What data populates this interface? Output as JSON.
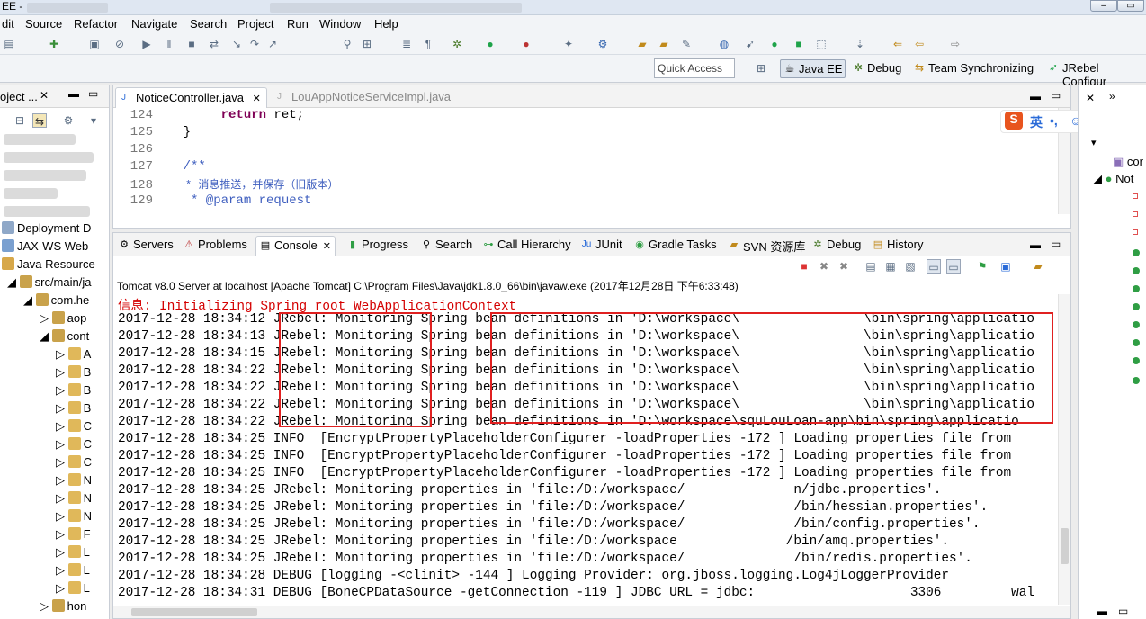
{
  "window": {
    "title_fragment": "EE -",
    "close_label": "✕",
    "max_label": "▭"
  },
  "menu": [
    "dit",
    "Source",
    "Refactor",
    "Navigate",
    "Search",
    "Project",
    "Run",
    "Window",
    "Help"
  ],
  "toolbar": {
    "quick_access": "Quick Access"
  },
  "perspectives": [
    {
      "label": "Java EE",
      "icon": "javaee-icon",
      "active": true
    },
    {
      "label": "Debug",
      "icon": "bug-icon"
    },
    {
      "label": "Team Synchronizing",
      "icon": "sync-icon"
    },
    {
      "label": "JRebel Configur",
      "icon": "jrebel-icon"
    }
  ],
  "explorer": {
    "tab_label": "oject ...",
    "items": [
      {
        "label": "Deployment D",
        "indent": 0
      },
      {
        "label": "JAX-WS Web",
        "indent": 0
      },
      {
        "label": "Java Resource",
        "indent": 0
      },
      {
        "label": "src/main/ja",
        "indent": 1
      },
      {
        "label": "com.he",
        "indent": 2
      },
      {
        "label": "aop",
        "indent": 3
      },
      {
        "label": "cont",
        "indent": 3
      }
    ],
    "class_letters": [
      "A",
      "B",
      "B",
      "B",
      "C",
      "C",
      "C",
      "N",
      "N",
      "N",
      "F",
      "L",
      "L",
      "L"
    ],
    "last_item": "hon"
  },
  "editor": {
    "tabs": [
      {
        "label": "NoticeController.java",
        "active": true
      },
      {
        "label": "LouAppNoticeServiceImpl.java",
        "active": false
      }
    ],
    "lines": [
      {
        "num": "124",
        "code": "        return ret;"
      },
      {
        "num": "125",
        "code": "    }"
      },
      {
        "num": "126",
        "code": ""
      },
      {
        "num": "127",
        "code": "    /**"
      },
      {
        "num": "128",
        "code": "     * 消息推送，并保存（旧版本）"
      },
      {
        "num": "129",
        "code": "     * @param request"
      }
    ]
  },
  "console": {
    "tabs": [
      {
        "label": "Servers",
        "icon": "servers-icon"
      },
      {
        "label": "Problems",
        "icon": "problems-icon"
      },
      {
        "label": "Console",
        "icon": "console-icon",
        "active": true
      },
      {
        "label": "Progress",
        "icon": "progress-icon"
      },
      {
        "label": "Search",
        "icon": "search-icon"
      },
      {
        "label": "Call Hierarchy",
        "icon": "hierarchy-icon"
      },
      {
        "label": "JUnit",
        "icon": "junit-icon"
      },
      {
        "label": "Gradle Tasks",
        "icon": "gradle-icon"
      },
      {
        "label": "SVN 资源库",
        "icon": "svn-icon"
      },
      {
        "label": "Debug",
        "icon": "bug-icon"
      },
      {
        "label": "History",
        "icon": "history-icon"
      }
    ],
    "status": "Tomcat v8.0 Server at localhost [Apache Tomcat] C:\\Program Files\\Java\\jdk1.8.0_66\\bin\\javaw.exe (2017年12月28日 下午6:33:48)",
    "lines": [
      {
        "text": "信息: Initializing Spring root WebApplicationContext",
        "red": true
      },
      {
        "text": "2017-12-28 18:34:12 JRebel: Monitoring Spring bean definitions in 'D:\\workspace\\                \\bin\\spring\\applicatio"
      },
      {
        "text": "2017-12-28 18:34:13 JRebel: Monitoring Spring bean definitions in 'D:\\workspace\\                \\bin\\spring\\applicatio"
      },
      {
        "text": "2017-12-28 18:34:15 JRebel: Monitoring Spring bean definitions in 'D:\\workspace\\                \\bin\\spring\\applicatio"
      },
      {
        "text": "2017-12-28 18:34:22 JRebel: Monitoring Spring bean definitions in 'D:\\workspace\\                \\bin\\spring\\applicatio"
      },
      {
        "text": "2017-12-28 18:34:22 JRebel: Monitoring Spring bean definitions in 'D:\\workspace\\                \\bin\\spring\\applicatio"
      },
      {
        "text": "2017-12-28 18:34:22 JRebel: Monitoring Spring bean definitions in 'D:\\workspace\\                \\bin\\spring\\applicatio"
      },
      {
        "text": "2017-12-28 18:34:22 JRebel: Monitoring Spring bean definitions in 'D:\\workspace\\squLouLoan-app\\bin\\spring\\applicatio"
      },
      {
        "text": "2017-12-28 18:34:25 INFO  [EncryptPropertyPlaceholderConfigurer -loadProperties -172 ] Loading properties file from"
      },
      {
        "text": "2017-12-28 18:34:25 INFO  [EncryptPropertyPlaceholderConfigurer -loadProperties -172 ] Loading properties file from"
      },
      {
        "text": "2017-12-28 18:34:25 INFO  [EncryptPropertyPlaceholderConfigurer -loadProperties -172 ] Loading properties file from"
      },
      {
        "text": "2017-12-28 18:34:25 JRebel: Monitoring properties in 'file:/D:/workspace/              n/jdbc.properties'."
      },
      {
        "text": "2017-12-28 18:34:25 JRebel: Monitoring properties in 'file:/D:/workspace/              /bin/hessian.properties'."
      },
      {
        "text": "2017-12-28 18:34:25 JRebel: Monitoring properties in 'file:/D:/workspace/              /bin/config.properties'."
      },
      {
        "text": "2017-12-28 18:34:25 JRebel: Monitoring properties in 'file:/D:/workspace              /bin/amq.properties'."
      },
      {
        "text": "2017-12-28 18:34:25 JRebel: Monitoring properties in 'file:/D:/workspace/              /bin/redis.properties'."
      },
      {
        "text": "2017-12-28 18:34:28 DEBUG [logging -<clinit> -144 ] Logging Provider: org.jboss.logging.Log4jLoggerProvider"
      },
      {
        "text": "2017-12-28 18:34:31 DEBUG [BoneCPDataSource -getConnection -119 ] JDBC URL = jdbc:                    3306         wal"
      }
    ]
  },
  "right_pane": {
    "items": [
      "cor",
      "Not"
    ]
  },
  "ime": {
    "logo": "S",
    "lang": "英"
  },
  "colors": {
    "error_text": "#d40000",
    "highlight_box": "#e02020",
    "keyword": "#7f0055",
    "comment": "#3f5fbf"
  }
}
